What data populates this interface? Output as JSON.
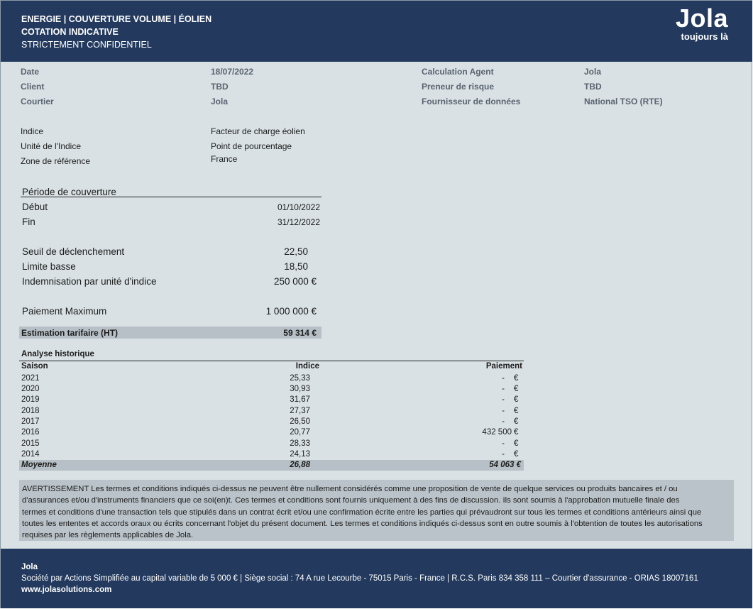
{
  "header": {
    "line1": "ENERGIE |  COUVERTURE VOLUME | ÉOLIEN",
    "line2": "COTATION INDICATIVE",
    "line3": "STRICTEMENT CONFIDENTIEL",
    "logo_name": "Jola",
    "logo_tagline": "toujours là"
  },
  "meta": {
    "date_label": "Date",
    "date_value": "18/07/2022",
    "client_label": "Client",
    "client_value": "TBD",
    "broker_label": "Courtier",
    "broker_value": "Jola",
    "calc_agent_label": "Calculation Agent",
    "calc_agent_value": "Jola",
    "risk_taker_label": "Preneur de risque",
    "risk_taker_value": "TBD",
    "data_provider_label": "Fournisseur de données",
    "data_provider_value": "National TSO (RTE)"
  },
  "index": {
    "indice_label": "Indice",
    "indice_value": "Facteur de charge éolien",
    "unit_label": "Unité de l'Indice",
    "unit_value": "Point de pourcentage",
    "zone_label": "Zone de référence",
    "zone_value": "France"
  },
  "coverage": {
    "title": "Période de couverture",
    "start_label": "Début",
    "start_value": "01/10/2022",
    "end_label": "Fin",
    "end_value": "31/12/2022",
    "trigger_label": "Seuil de déclenchement",
    "trigger_value": "22,50",
    "lower_label": "Limite basse",
    "lower_value": "18,50",
    "indemnity_label": "Indemnisation par unité d'indice",
    "indemnity_value": "250 000 €",
    "max_label": "Paiement Maximum",
    "max_value": "1 000 000 €",
    "estimate_label": "Estimation tarifaire (HT)",
    "estimate_value": "59 314 €"
  },
  "history": {
    "title": "Analyse historique",
    "col_season": "Saison",
    "col_index": "Indice",
    "col_payment": "Paiement",
    "rows": [
      {
        "season": "2021",
        "index": "25,33",
        "payment": "-",
        "currency": "€"
      },
      {
        "season": "2020",
        "index": "30,93",
        "payment": "-",
        "currency": "€"
      },
      {
        "season": "2019",
        "index": "31,67",
        "payment": "-",
        "currency": "€"
      },
      {
        "season": "2018",
        "index": "27,37",
        "payment": "-",
        "currency": "€"
      },
      {
        "season": "2017",
        "index": "26,50",
        "payment": "-",
        "currency": "€"
      },
      {
        "season": "2016",
        "index": "20,77",
        "payment": "432 500",
        "currency": "€"
      },
      {
        "season": "2015",
        "index": "28,33",
        "payment": "-",
        "currency": "€"
      },
      {
        "season": "2014",
        "index": "24,13",
        "payment": "-",
        "currency": "€"
      }
    ],
    "avg_label": "Moyenne",
    "avg_index": "26,88",
    "avg_payment": "54 063 €"
  },
  "disclaimer": {
    "line1": "AVERTISSEMENT Les termes et conditions indiqués ci-dessus ne peuvent être nullement considérés comme une proposition de vente de quelque services ou produits bancaires et / ou",
    "line2": "d'assurances et/ou d'instruments financiers que ce soi(en)t. Ces termes et conditions sont fournis uniquement à des fins de discussion. Ils sont soumis à l'approbation mutuelle finale des",
    "line3": "termes et conditions d'une transaction tels que stipulés dans un contrat écrit et/ou une confirmation écrite entre les parties qui prévaudront sur tous les termes et conditions antérieurs ainsi que",
    "line4": "toutes les ententes et accords oraux ou écrits concernant l'objet du présent document. Les termes et conditions indiqués ci-dessus sont en outre soumis à l'obtention de toutes les autorisations",
    "line5": "requises par les règlements applicables de Jola."
  },
  "footer": {
    "company": "Jola",
    "legal": "Société par Actions Simplifiée au capital variable de 5 000 € | Siège social : 74 A rue Lecourbe - 75015 Paris - France | R.C.S. Paris 834 358 111 – Courtier d'assurance - ORIAS 18007161",
    "website": "www.jolasolutions.com"
  }
}
